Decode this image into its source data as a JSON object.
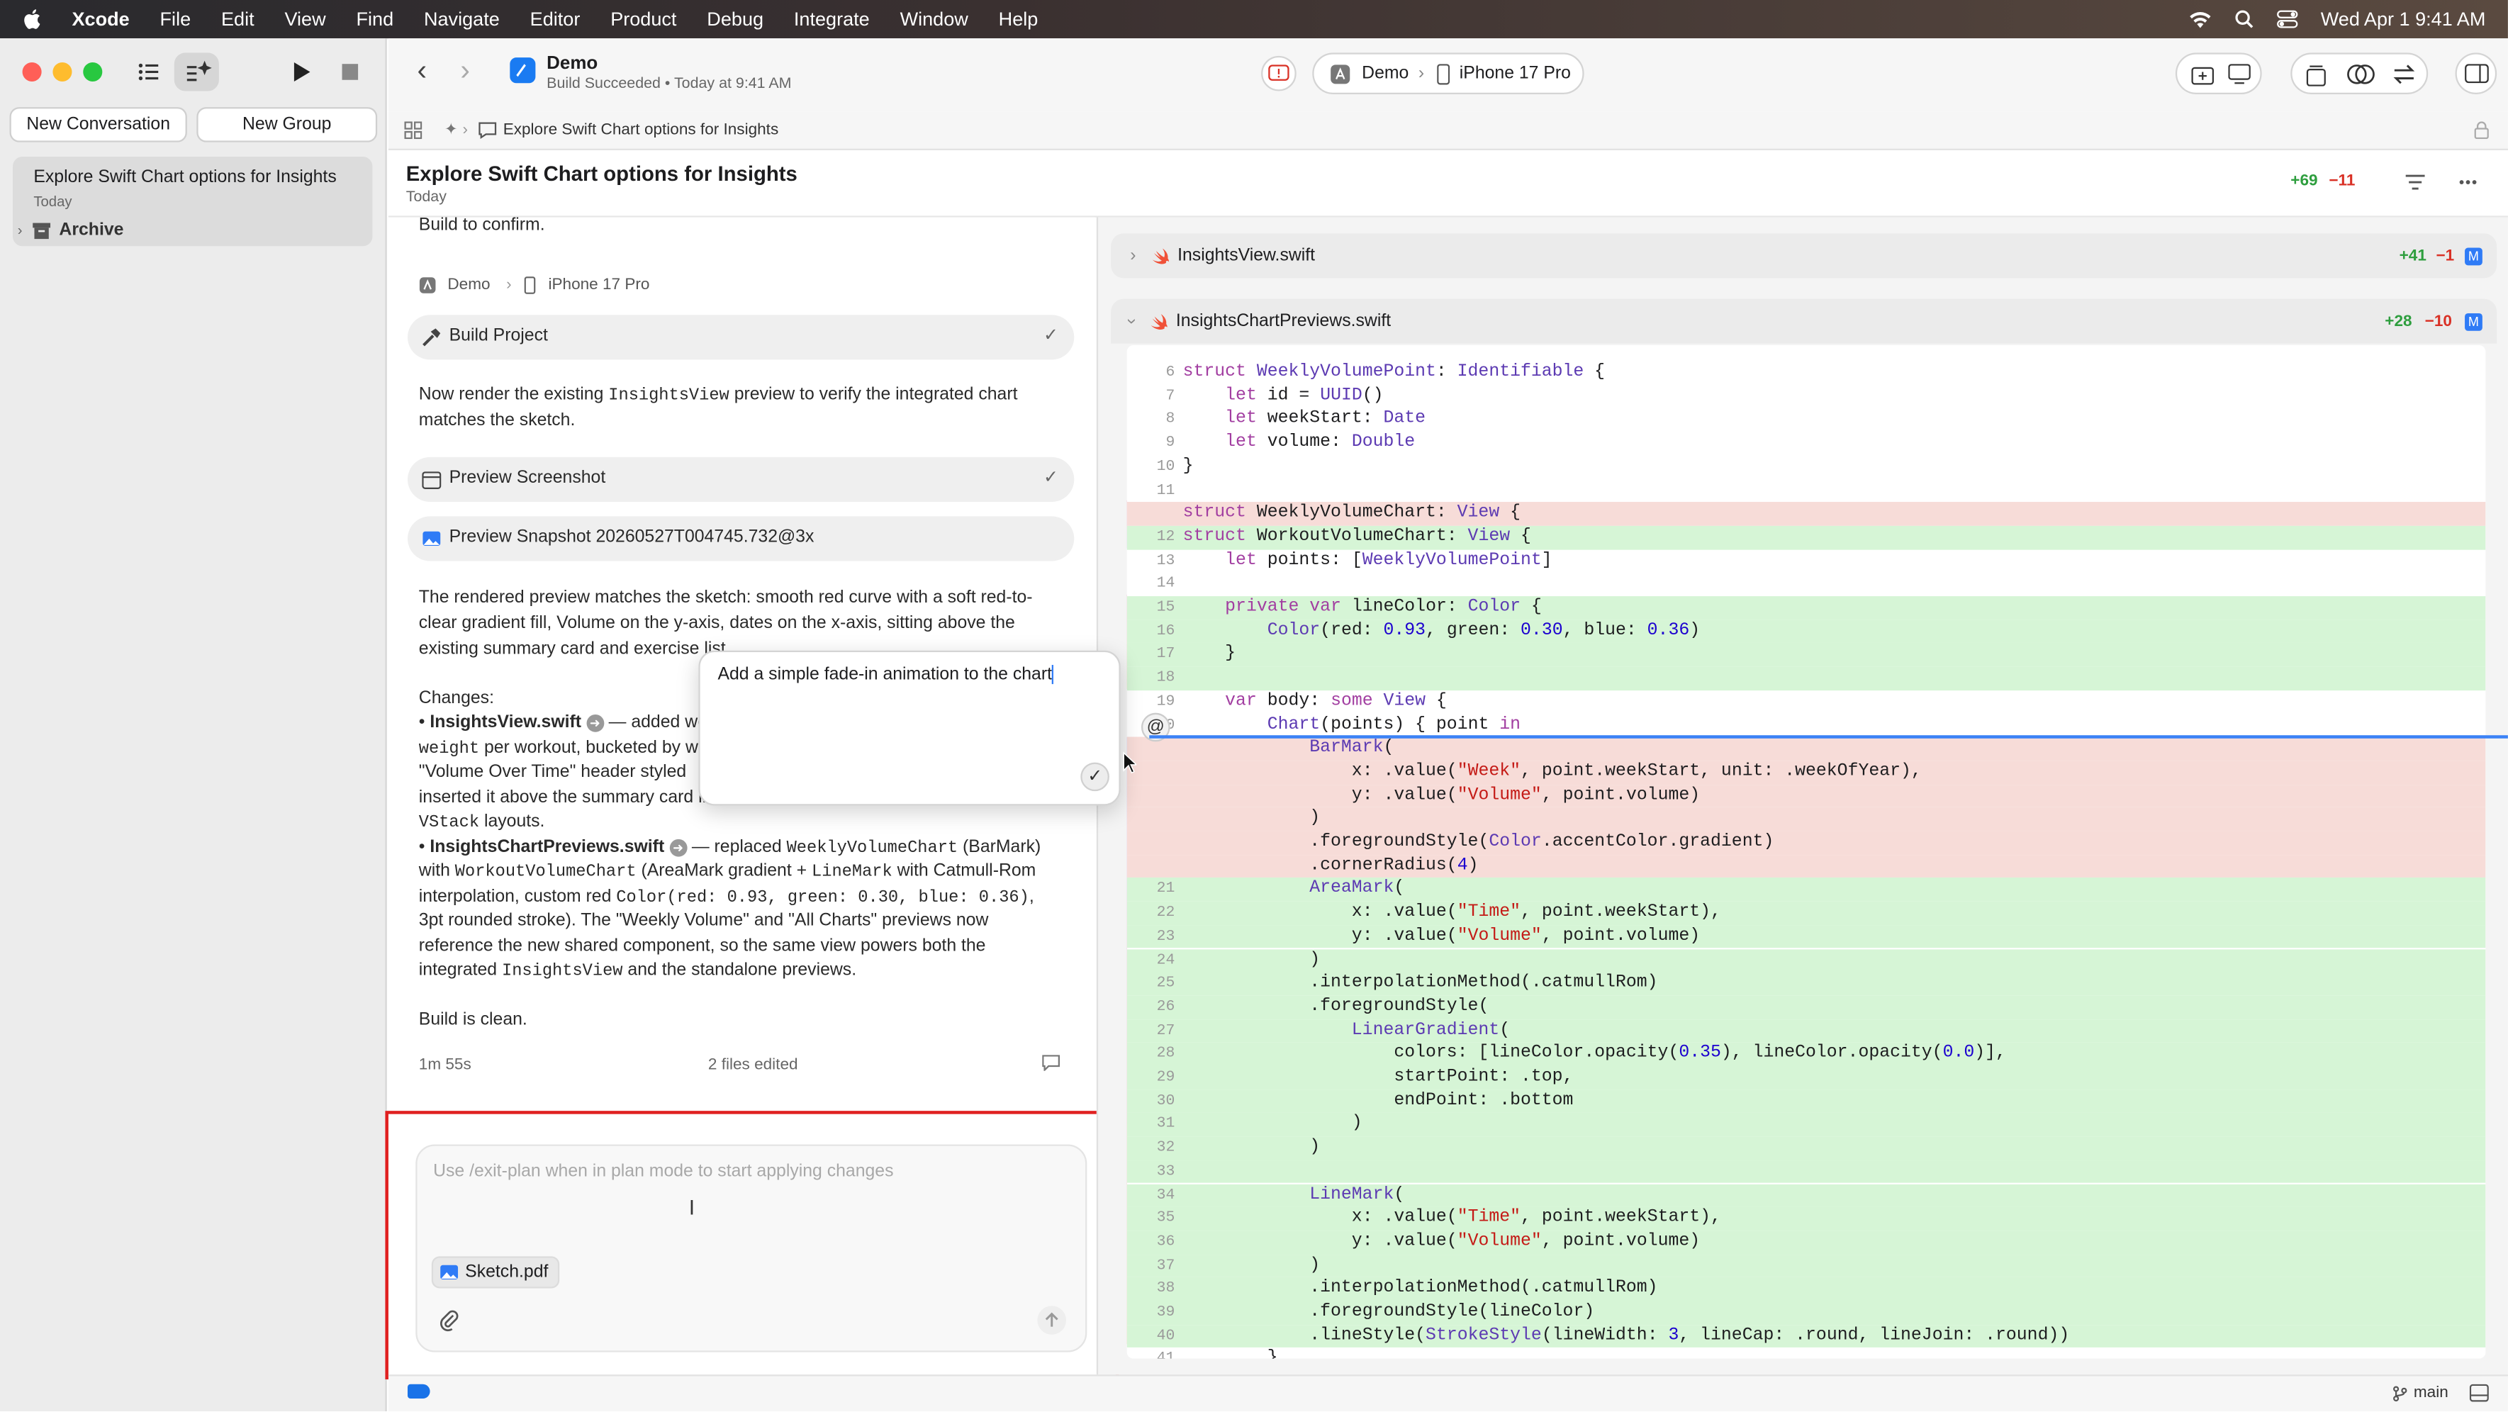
{
  "menubar": {
    "app": "Xcode",
    "items": [
      "File",
      "Edit",
      "View",
      "Find",
      "Navigate",
      "Editor",
      "Product",
      "Debug",
      "Integrate",
      "Window",
      "Help"
    ],
    "datetime": "Wed Apr 1  9:41 AM"
  },
  "sidebar": {
    "new_conversation": "New Conversation",
    "new_group": "New Group",
    "conversation_title": "Explore Swift Chart options for Insights",
    "conversation_date": "Today",
    "archive": "Archive"
  },
  "toolbar": {
    "project": "Demo",
    "status": "Build Succeeded • Today at 9:41 AM",
    "scheme": "Demo",
    "device": "iPhone 17 Pro"
  },
  "crumb": {
    "label": "Explore Swift Chart options for Insights"
  },
  "title": {
    "text": "Explore Swift Chart options for Insights",
    "date": "Today",
    "added": "+69",
    "removed": "−11"
  },
  "chat": {
    "build_confirm": "Build to confirm.",
    "dest_scheme": "Demo",
    "dest_device": "iPhone 17 Pro",
    "build_project": "Build Project",
    "render_pre": "Now render the existing ",
    "render_code": "InsightsView",
    "render_post": " preview to verify the integrated chart",
    "render_line2": "matches the sketch.",
    "preview_screenshot": "Preview Screenshot",
    "preview_snapshot": "Preview Snapshot 20260527T004745.732@3x",
    "result_l1": "The rendered preview matches the sketch: smooth red curve with a soft red-to-",
    "result_l2": "clear gradient fill, Volume on the y-axis, dates on the x-axis, sitting above the",
    "result_l3": "existing summary card and exercise list.",
    "changes": "Changes:",
    "c1_file": "InsightsView.swift",
    "c1_text": " — added weekly volume aggregation (reps ×",
    "c1_l2_code": "weight",
    "c1_l2": " per workout, bucketed by week) and a",
    "c1_l3": "\"Volume Over Time\" header styled",
    "c1_l4": "inserted it above the summary card in",
    "c1_l5_code": "VStack",
    "c1_l5": " layouts.",
    "c2_file": "InsightsChartPreviews.swift",
    "c2_text": " — replaced ",
    "c2_code1": "WeeklyVolumeChart",
    "c2_text2": " (BarMark)",
    "c2_l2a": "with ",
    "c2_l2code": "WorkoutVolumeChart",
    "c2_l2b": " (AreaMark gradient + ",
    "c2_l2code2": "LineMark",
    "c2_l2c": " with Catmull-Rom",
    "c2_l3a": "interpolation, custom red ",
    "c2_l3code": "Color(red: 0.93, green: 0.30, blue: 0.36)",
    "c2_l3b": ",",
    "c2_l4": "3pt rounded stroke). The \"Weekly Volume\" and \"All Charts\" previews now",
    "c2_l5": "reference the new shared component, so the same view powers both the",
    "c2_l6a": "integrated ",
    "c2_l6code": "InsightsView",
    "c2_l6b": " and the standalone previews.",
    "clean": "Build is clean.",
    "duration": "1m 55s",
    "files_edited": "2 files edited"
  },
  "composer": {
    "placeholder": "Use /exit-plan when in plan mode to start applying changes",
    "attachment": "Sketch.pdf"
  },
  "popup": {
    "text": "Add a simple fade-in animation to the chart"
  },
  "files": [
    {
      "name": "InsightsView.swift",
      "added": "+41",
      "removed": "−1",
      "badge": "M"
    },
    {
      "name": "InsightsChartPreviews.swift",
      "added": "+28",
      "removed": "−10",
      "badge": "M"
    }
  ],
  "code": [
    {
      "n": "6",
      "t": "struct WeeklyVolumePoint: Identifiable {",
      "k": ""
    },
    {
      "n": "7",
      "t": "    let id = UUID()",
      "k": ""
    },
    {
      "n": "8",
      "t": "    let weekStart: Date",
      "k": ""
    },
    {
      "n": "9",
      "t": "    let volume: Double",
      "k": ""
    },
    {
      "n": "10",
      "t": "}",
      "k": ""
    },
    {
      "n": "11",
      "t": "",
      "k": ""
    },
    {
      "n": "",
      "t": "struct WeeklyVolumeChart: View {",
      "k": "rem"
    },
    {
      "n": "12",
      "t": "struct WorkoutVolumeChart: View {",
      "k": "add"
    },
    {
      "n": "13",
      "t": "    let points: [WeeklyVolumePoint]",
      "k": ""
    },
    {
      "n": "14",
      "t": "",
      "k": ""
    },
    {
      "n": "15",
      "t": "    private var lineColor: Color {",
      "k": "add"
    },
    {
      "n": "16",
      "t": "        Color(red: 0.93, green: 0.30, blue: 0.36)",
      "k": "add"
    },
    {
      "n": "17",
      "t": "    }",
      "k": "add"
    },
    {
      "n": "18",
      "t": "",
      "k": "add"
    },
    {
      "n": "19",
      "t": "    var body: some View {",
      "k": ""
    },
    {
      "n": "20",
      "t": "        Chart(points) { point in",
      "k": ""
    },
    {
      "n": "",
      "t": "            BarMark(",
      "k": "rem"
    },
    {
      "n": "",
      "t": "                x: .value(\"Week\", point.weekStart, unit: .weekOfYear),",
      "k": "rem"
    },
    {
      "n": "",
      "t": "                y: .value(\"Volume\", point.volume)",
      "k": "rem"
    },
    {
      "n": "",
      "t": "            )",
      "k": "rem"
    },
    {
      "n": "",
      "t": "            .foregroundStyle(Color.accentColor.gradient)",
      "k": "rem"
    },
    {
      "n": "",
      "t": "            .cornerRadius(4)",
      "k": "rem"
    },
    {
      "n": "21",
      "t": "            AreaMark(",
      "k": "add"
    },
    {
      "n": "22",
      "t": "                x: .value(\"Time\", point.weekStart),",
      "k": "add"
    },
    {
      "n": "23",
      "t": "                y: .value(\"Volume\", point.volume)",
      "k": "add"
    },
    {
      "n": "24",
      "t": "            )",
      "k": "add"
    },
    {
      "n": "25",
      "t": "            .interpolationMethod(.catmullRom)",
      "k": "add"
    },
    {
      "n": "26",
      "t": "            .foregroundStyle(",
      "k": "add"
    },
    {
      "n": "27",
      "t": "                LinearGradient(",
      "k": "add"
    },
    {
      "n": "28",
      "t": "                    colors: [lineColor.opacity(0.35), lineColor.opacity(0.0)],",
      "k": "add"
    },
    {
      "n": "29",
      "t": "                    startPoint: .top,",
      "k": "add"
    },
    {
      "n": "30",
      "t": "                    endPoint: .bottom",
      "k": "add"
    },
    {
      "n": "31",
      "t": "                )",
      "k": "add"
    },
    {
      "n": "32",
      "t": "            )",
      "k": "add"
    },
    {
      "n": "33",
      "t": "",
      "k": "add"
    },
    {
      "n": "34",
      "t": "            LineMark(",
      "k": "add"
    },
    {
      "n": "35",
      "t": "                x: .value(\"Time\", point.weekStart),",
      "k": "add"
    },
    {
      "n": "36",
      "t": "                y: .value(\"Volume\", point.volume)",
      "k": "add"
    },
    {
      "n": "37",
      "t": "            )",
      "k": "add"
    },
    {
      "n": "38",
      "t": "            .interpolationMethod(.catmullRom)",
      "k": "add"
    },
    {
      "n": "39",
      "t": "            .foregroundStyle(lineColor)",
      "k": "add"
    },
    {
      "n": "40",
      "t": "            .lineStyle(StrokeStyle(lineWidth: 3, lineCap: .round, lineJoin: .round))",
      "k": "add"
    },
    {
      "n": "41",
      "t": "        }",
      "k": ""
    }
  ],
  "statusbar": {
    "branch": "main"
  },
  "colors": {
    "accent": "#0a84ff",
    "added": "#2e9e3e",
    "removed": "#d93025",
    "highlight": "#e02020"
  }
}
